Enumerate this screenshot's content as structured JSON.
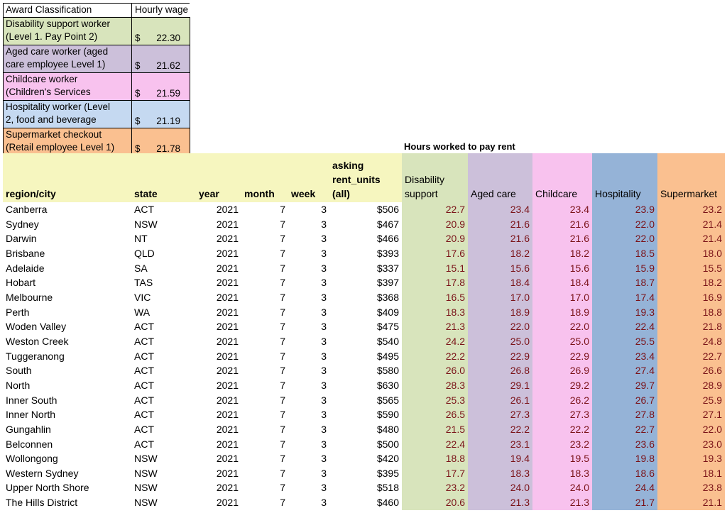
{
  "award_table": {
    "header": {
      "classification": "Award Classification",
      "wage": "Hourly wage"
    },
    "rows": [
      {
        "line1": "Disability support worker",
        "line2": "(Level 1. Pay Point 2)",
        "currency": "$",
        "wage": "22.30",
        "color": "#d8e4bc"
      },
      {
        "line1": "Aged care worker (aged",
        "line2": "care employee Level 1)",
        "currency": "$",
        "wage": "21.62",
        "color": "#ccc0da"
      },
      {
        "line1": "Childcare worker",
        "line2": "(Children's Services",
        "currency": "$",
        "wage": "21.59",
        "color": "#f8c2ee"
      },
      {
        "line1": "Hospitality worker (Level",
        "line2": "2, food and beverage",
        "currency": "$",
        "wage": "21.19",
        "color": "#c5d9f1"
      },
      {
        "line1": "Supermarket checkout",
        "line2": "(Retail employee Level 1)",
        "currency": "$",
        "wage": "21.78",
        "color": "#fac090"
      }
    ]
  },
  "hours_title": "Hours worked to pay rent",
  "main_table": {
    "headers": {
      "region": "region/city",
      "state": "state",
      "year": "year",
      "month": "month",
      "week": "week",
      "rent_line1": "asking",
      "rent_line2": "rent_units",
      "rent_line3": "(all)",
      "disability_line1": "Disability",
      "disability_line2": "support",
      "aged": "Aged care",
      "childcare": "Childcare",
      "hospitality": "Hospitality",
      "supermarket": "Supermarket"
    },
    "rows": [
      {
        "region": "Canberra",
        "state": "ACT",
        "year": "2021",
        "month": "7",
        "week": "3",
        "rent": "$506",
        "dis": "22.7",
        "aged": "23.4",
        "child": "23.4",
        "hosp": "23.9",
        "super": "23.2"
      },
      {
        "region": "Sydney",
        "state": "NSW",
        "year": "2021",
        "month": "7",
        "week": "3",
        "rent": "$467",
        "dis": "20.9",
        "aged": "21.6",
        "child": "21.6",
        "hosp": "22.0",
        "super": "21.4"
      },
      {
        "region": "Darwin",
        "state": "NT",
        "year": "2021",
        "month": "7",
        "week": "3",
        "rent": "$466",
        "dis": "20.9",
        "aged": "21.6",
        "child": "21.6",
        "hosp": "22.0",
        "super": "21.4"
      },
      {
        "region": "Brisbane",
        "state": "QLD",
        "year": "2021",
        "month": "7",
        "week": "3",
        "rent": "$393",
        "dis": "17.6",
        "aged": "18.2",
        "child": "18.2",
        "hosp": "18.5",
        "super": "18.0"
      },
      {
        "region": "Adelaide",
        "state": "SA",
        "year": "2021",
        "month": "7",
        "week": "3",
        "rent": "$337",
        "dis": "15.1",
        "aged": "15.6",
        "child": "15.6",
        "hosp": "15.9",
        "super": "15.5"
      },
      {
        "region": "Hobart",
        "state": "TAS",
        "year": "2021",
        "month": "7",
        "week": "3",
        "rent": "$397",
        "dis": "17.8",
        "aged": "18.4",
        "child": "18.4",
        "hosp": "18.7",
        "super": "18.2"
      },
      {
        "region": "Melbourne",
        "state": "VIC",
        "year": "2021",
        "month": "7",
        "week": "3",
        "rent": "$368",
        "dis": "16.5",
        "aged": "17.0",
        "child": "17.0",
        "hosp": "17.4",
        "super": "16.9"
      },
      {
        "region": "Perth",
        "state": "WA",
        "year": "2021",
        "month": "7",
        "week": "3",
        "rent": "$409",
        "dis": "18.3",
        "aged": "18.9",
        "child": "18.9",
        "hosp": "19.3",
        "super": "18.8"
      },
      {
        "region": "Woden Valley",
        "state": "ACT",
        "year": "2021",
        "month": "7",
        "week": "3",
        "rent": "$475",
        "dis": "21.3",
        "aged": "22.0",
        "child": "22.0",
        "hosp": "22.4",
        "super": "21.8"
      },
      {
        "region": "Weston Creek",
        "state": "ACT",
        "year": "2021",
        "month": "7",
        "week": "3",
        "rent": "$540",
        "dis": "24.2",
        "aged": "25.0",
        "child": "25.0",
        "hosp": "25.5",
        "super": "24.8"
      },
      {
        "region": "Tuggeranong",
        "state": "ACT",
        "year": "2021",
        "month": "7",
        "week": "3",
        "rent": "$495",
        "dis": "22.2",
        "aged": "22.9",
        "child": "22.9",
        "hosp": "23.4",
        "super": "22.7"
      },
      {
        "region": "South",
        "state": "ACT",
        "year": "2021",
        "month": "7",
        "week": "3",
        "rent": "$580",
        "dis": "26.0",
        "aged": "26.8",
        "child": "26.9",
        "hosp": "27.4",
        "super": "26.6"
      },
      {
        "region": "North",
        "state": "ACT",
        "year": "2021",
        "month": "7",
        "week": "3",
        "rent": "$630",
        "dis": "28.3",
        "aged": "29.1",
        "child": "29.2",
        "hosp": "29.7",
        "super": "28.9"
      },
      {
        "region": "Inner South",
        "state": "ACT",
        "year": "2021",
        "month": "7",
        "week": "3",
        "rent": "$565",
        "dis": "25.3",
        "aged": "26.1",
        "child": "26.2",
        "hosp": "26.7",
        "super": "25.9"
      },
      {
        "region": "Inner North",
        "state": "ACT",
        "year": "2021",
        "month": "7",
        "week": "3",
        "rent": "$590",
        "dis": "26.5",
        "aged": "27.3",
        "child": "27.3",
        "hosp": "27.8",
        "super": "27.1"
      },
      {
        "region": "Gungahlin",
        "state": "ACT",
        "year": "2021",
        "month": "7",
        "week": "3",
        "rent": "$480",
        "dis": "21.5",
        "aged": "22.2",
        "child": "22.2",
        "hosp": "22.7",
        "super": "22.0"
      },
      {
        "region": "Belconnen",
        "state": "ACT",
        "year": "2021",
        "month": "7",
        "week": "3",
        "rent": "$500",
        "dis": "22.4",
        "aged": "23.1",
        "child": "23.2",
        "hosp": "23.6",
        "super": "23.0"
      },
      {
        "region": "Wollongong",
        "state": "NSW",
        "year": "2021",
        "month": "7",
        "week": "3",
        "rent": "$420",
        "dis": "18.8",
        "aged": "19.4",
        "child": "19.5",
        "hosp": "19.8",
        "super": "19.3"
      },
      {
        "region": "Western Sydney",
        "state": "NSW",
        "year": "2021",
        "month": "7",
        "week": "3",
        "rent": "$395",
        "dis": "17.7",
        "aged": "18.3",
        "child": "18.3",
        "hosp": "18.6",
        "super": "18.1"
      },
      {
        "region": "Upper North Shore",
        "state": "NSW",
        "year": "2021",
        "month": "7",
        "week": "3",
        "rent": "$518",
        "dis": "23.2",
        "aged": "24.0",
        "child": "24.0",
        "hosp": "24.4",
        "super": "23.8"
      },
      {
        "region": "The Hills District",
        "state": "NSW",
        "year": "2021",
        "month": "7",
        "week": "3",
        "rent": "$460",
        "dis": "20.6",
        "aged": "21.3",
        "child": "21.3",
        "hosp": "21.7",
        "super": "21.1"
      }
    ]
  },
  "colors": {
    "header_yellow": "#f6f6bf",
    "disability": "#d8e4bc",
    "aged_care": "#ccc0da",
    "childcare": "#f8c2ee",
    "hospitality": "#95b3d7",
    "supermarket": "#fac090",
    "hours_text": "#7a1218"
  }
}
